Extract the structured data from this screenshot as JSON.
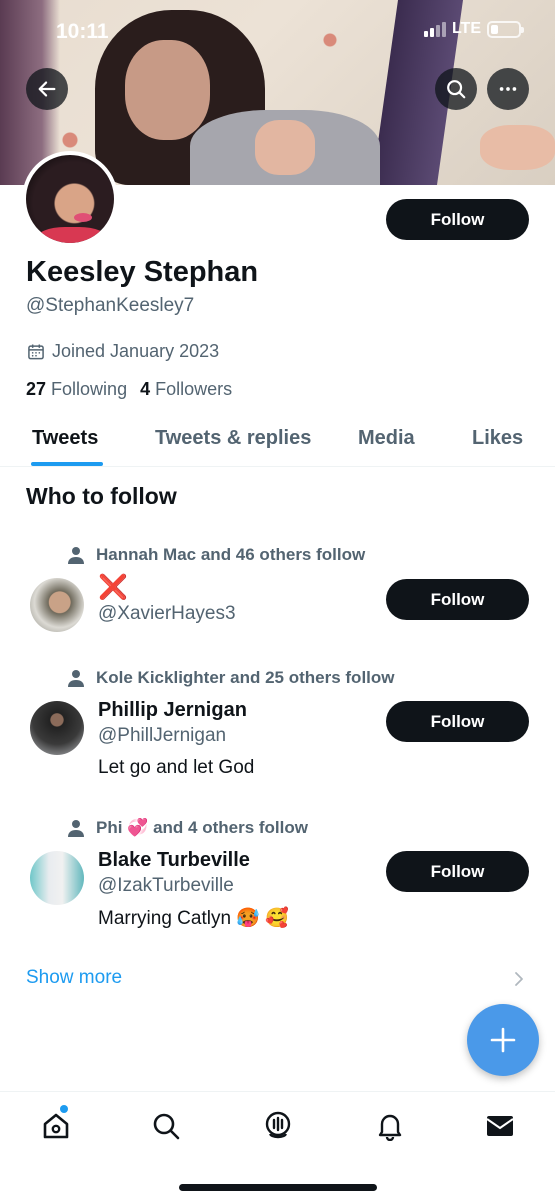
{
  "status_bar": {
    "time": "10:11",
    "network": "LTE"
  },
  "header": {
    "back_icon": "arrow-left-icon",
    "search_icon": "search-icon",
    "more_icon": "more-horizontal-icon"
  },
  "profile": {
    "follow_label": "Follow",
    "name": "Keesley Stephan",
    "handle": "@StephanKeesley7",
    "joined": "Joined January 2023",
    "following_count": "27",
    "following_label": "Following",
    "followers_count": "4",
    "followers_label": "Followers"
  },
  "tabs": [
    {
      "label": "Tweets",
      "active": true
    },
    {
      "label": "Tweets & replies",
      "active": false
    },
    {
      "label": "Media",
      "active": false
    },
    {
      "label": "Likes",
      "active": false
    }
  ],
  "who_to_follow": {
    "title": "Who to follow",
    "users": [
      {
        "social_context": "Hannah Mac and 46 others follow",
        "name": "❌",
        "handle": "@XavierHayes3",
        "bio": "",
        "follow_label": "Follow"
      },
      {
        "social_context": "Kole Kicklighter and 25 others follow",
        "name": "Phillip Jernigan",
        "handle": "@PhillJernigan",
        "bio": "Let go and let God",
        "follow_label": "Follow"
      },
      {
        "social_context_name": "Phi 💞",
        "social_context_rest": "and 4 others follow",
        "name": "Blake Turbeville",
        "handle": "@IzakTurbeville",
        "bio": "Marrying Catlyn 🥵 🥰",
        "follow_label": "Follow"
      }
    ],
    "show_more": "Show more"
  },
  "fab": {
    "icon": "plus-icon"
  },
  "bottom_nav": [
    "home-icon",
    "search-icon",
    "spaces-icon",
    "notifications-icon",
    "messages-icon"
  ],
  "colors": {
    "accent": "#1d9bf0",
    "fab": "#4a99e9",
    "text": "#0f1419",
    "secondary": "#536471"
  }
}
